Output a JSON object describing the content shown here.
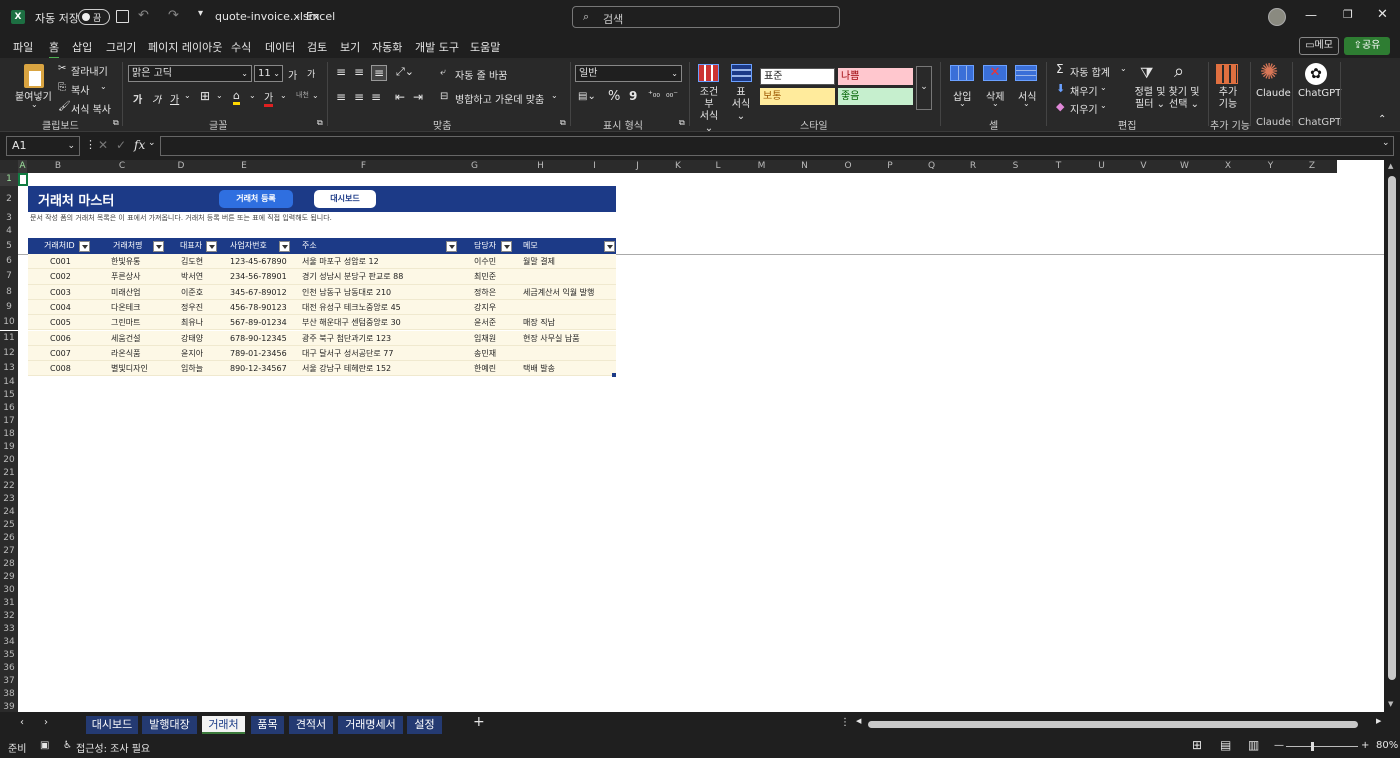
{
  "titlebar": {
    "autosave_label": "자동 저장",
    "autosave_state": "끔",
    "filename": "quote-invoice.xlsm",
    "app": "Excel",
    "search_placeholder": "검색"
  },
  "menu": [
    "파일",
    "홈",
    "삽입",
    "그리기",
    "페이지 레이아웃",
    "수식",
    "데이터",
    "검토",
    "보기",
    "자동화",
    "개발 도구",
    "도움말"
  ],
  "menu_right": {
    "comment": "메모",
    "share": "공유"
  },
  "ribbon": {
    "clipboard": {
      "paste": "붙여넣기",
      "cut": "잘라내기",
      "copy": "복사",
      "format_painter": "서식 복사",
      "label": "클립보드"
    },
    "font": {
      "name": "맑은 고딕",
      "size": "11",
      "label": "글꼴",
      "grow": "가",
      "shrink": "가",
      "bold": "가",
      "italic": "가",
      "underline": "가",
      "phonetic": "내천"
    },
    "align": {
      "wrap": "자동 줄 바꿈",
      "merge": "병합하고 가운데 맞춤",
      "label": "맞춤"
    },
    "number": {
      "format": "일반",
      "percent": "%",
      "comma": "9",
      "label": "표시 형식"
    },
    "styles": {
      "cond": "조건부 서식",
      "table": "표 서식",
      "normal": "표준",
      "bad": "나쁨",
      "neutral": "보통",
      "good": "좋음",
      "label": "스타일"
    },
    "cells": {
      "insert": "삽입",
      "delete": "삭제",
      "format": "서식",
      "label": "셀"
    },
    "editing": {
      "autosum": "자동 합계",
      "fill": "채우기",
      "clear": "지우기",
      "sort": "정렬 및 필터",
      "find": "찾기 및 선택",
      "label": "편집"
    },
    "addins": {
      "label": "추가 기능",
      "btn": "추가 기능"
    },
    "claude": {
      "label": "Claude",
      "btn": "Claude"
    },
    "chatgpt": {
      "label": "ChatGPT",
      "btn": "ChatGPT"
    }
  },
  "formula_bar": {
    "name_box": "A1",
    "fx": "fx",
    "value": ""
  },
  "columns": [
    "A",
    "B",
    "C",
    "D",
    "E",
    "F",
    "G",
    "H",
    "I",
    "J",
    "K",
    "L",
    "M",
    "N",
    "O",
    "P",
    "Q",
    "R",
    "S",
    "T",
    "U",
    "V",
    "W",
    "X",
    "Y",
    "Z"
  ],
  "sheet": {
    "title": "거래처 마스터",
    "btn_register": "거래처 등록",
    "btn_dashboard": "대시보드",
    "subtitle": "문서 작성 폼의 거래처 목록은 이 표에서 가져옵니다. 거래처 등록 버튼 또는 표에 직접 입력해도 됩니다.",
    "headers": [
      "거래처ID",
      "거래처명",
      "대표자",
      "사업자번호",
      "주소",
      "담당자",
      "메모"
    ],
    "rows": [
      [
        "C001",
        "한빛유통",
        "김도현",
        "123-45-67890",
        "서울 마포구 성암로 12",
        "이수민",
        "월말 결제"
      ],
      [
        "C002",
        "푸른상사",
        "박서연",
        "234-56-78901",
        "경기 성남시 분당구 판교로 88",
        "최민준",
        ""
      ],
      [
        "C003",
        "미래산업",
        "이준호",
        "345-67-89012",
        "인천 남동구 남동대로 210",
        "정하은",
        "세금계산서 익월 발행"
      ],
      [
        "C004",
        "다온테크",
        "정우진",
        "456-78-90123",
        "대전 유성구 테크노중앙로 45",
        "강지우",
        ""
      ],
      [
        "C005",
        "그린마트",
        "최유나",
        "567-89-01234",
        "부산 해운대구 센텀중앙로 30",
        "윤서준",
        "매장 직납"
      ],
      [
        "C006",
        "세움건설",
        "강태양",
        "678-90-12345",
        "광주 북구 첨단과기로 123",
        "임채원",
        "현장 사무실 납품"
      ],
      [
        "C007",
        "라온식품",
        "윤지아",
        "789-01-23456",
        "대구 달서구 성서공단로 77",
        "송민재",
        ""
      ],
      [
        "C008",
        "별빛디자인",
        "임하늘",
        "890-12-34567",
        "서울 강남구 테헤란로 152",
        "한예린",
        "택배 발송"
      ]
    ]
  },
  "tabs": [
    "대시보드",
    "발행대장",
    "거래처",
    "품목",
    "견적서",
    "거래명세서",
    "설정"
  ],
  "active_tab": "거래처",
  "status": {
    "ready": "준비",
    "accessibility": "접근성: 조사 필요",
    "zoom": "80%"
  },
  "colors": {
    "header_navy": "#1c3a87",
    "row_cream": "#fdf8e6",
    "button_blue": "#2f6fe0",
    "accent_green": "#2e7d32"
  }
}
